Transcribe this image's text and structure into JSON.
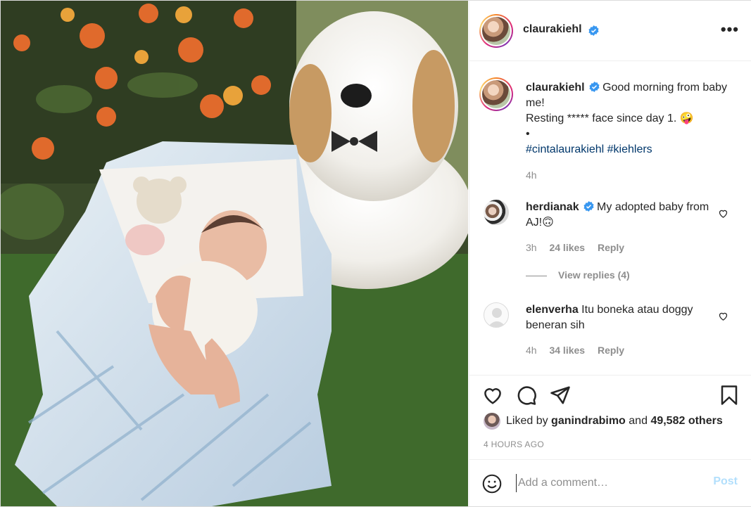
{
  "post": {
    "author": "claurakiehl",
    "caption": {
      "author": "claurakiehl",
      "line1": "Good morning from baby me!",
      "line2": "Resting ***** face since day 1. 🤪",
      "bullet": "•",
      "tags": [
        "#cintalaurakiehl",
        "#kiehlers"
      ],
      "age": "4h"
    },
    "comments": [
      {
        "author": "herdianak",
        "verified": true,
        "text": "My adopted baby from AJ!🙃",
        "age": "3h",
        "likes": "24 likes",
        "reply": "Reply"
      },
      {
        "author": "elenverha",
        "verified": false,
        "text": "Itu boneka atau doggy beneran sih",
        "age": "4h",
        "likes": "34 likes",
        "reply": "Reply"
      }
    ],
    "view_replies": "View replies (4)",
    "liked_by": {
      "prefix": "Liked by",
      "user": "ganindrabimo",
      "joiner": "and",
      "others": "49,582 others"
    },
    "timestamp": "4 HOURS AGO",
    "add_comment_placeholder": "Add a comment…",
    "post_label": "Post"
  },
  "icons": {
    "more": "more-options-icon",
    "verified": "verified-badge-icon",
    "like": "heart-icon",
    "comment": "comment-bubble-icon",
    "share": "paper-plane-icon",
    "save": "bookmark-icon",
    "emoji": "emoji-icon"
  },
  "colors": {
    "verified": "#3897f0",
    "tag": "#00376b",
    "muted": "#8e8e8e",
    "post_disabled": "#b2dffc"
  }
}
